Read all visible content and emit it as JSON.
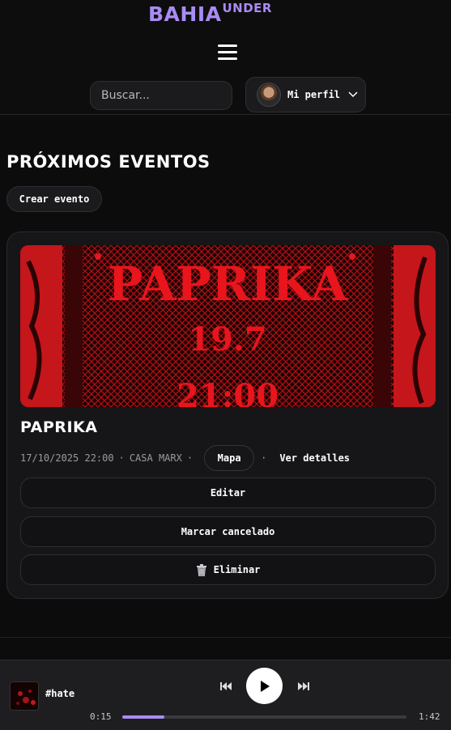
{
  "header": {
    "logo_main": "BAHIA",
    "logo_sup": "UNDER",
    "search_placeholder": "Buscar...",
    "profile_label": "Mi perfil"
  },
  "main": {
    "section_title": "PRÓXIMOS EVENTOS",
    "create_button": "Crear evento"
  },
  "event": {
    "poster_text": "PAPRIKA",
    "poster_date": "19.7",
    "poster_time": "21:00",
    "name": "PAPRIKA",
    "datetime": "17/10/2025 22:00",
    "venue": "CASA MARX",
    "separator": "·",
    "map_button": "Mapa",
    "details_link": "Ver detalles",
    "edit_button": "Editar",
    "cancel_button": "Marcar cancelado",
    "delete_button": "Eliminar"
  },
  "player": {
    "track_name": "#hate",
    "elapsed": "0:15",
    "duration": "1:42",
    "progress_fraction": 0.147
  },
  "colors": {
    "accent": "#a98bf4",
    "poster_red": "#d4141a"
  }
}
